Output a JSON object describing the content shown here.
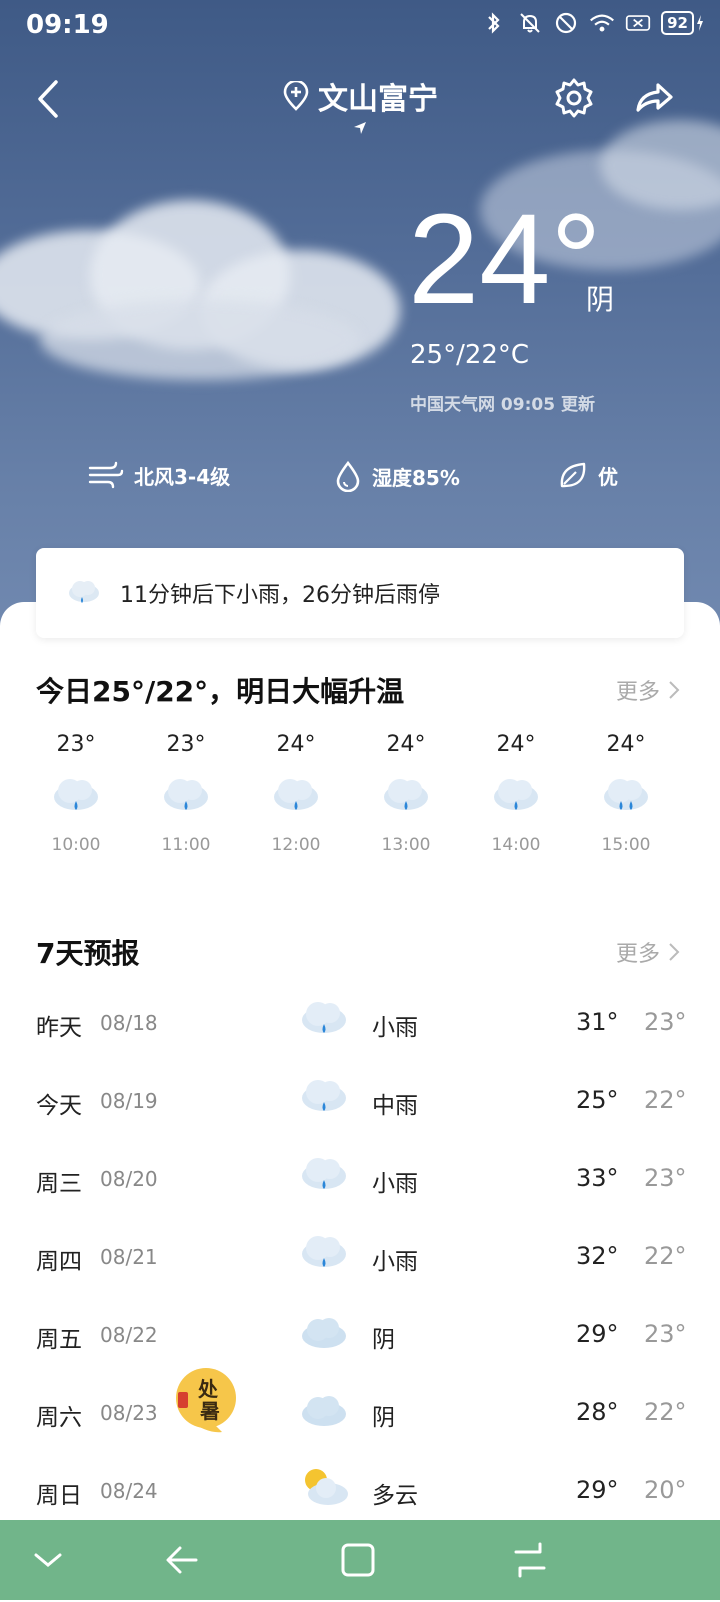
{
  "status": {
    "time": "09:19",
    "battery": "92",
    "icons": [
      "bluetooth-icon",
      "bell-off-icon",
      "do-not-disturb-icon",
      "wifi-icon",
      "no-sim-icon",
      "battery-icon",
      "charging-icon"
    ]
  },
  "header": {
    "location": "文山富宁"
  },
  "current": {
    "temp": "24°",
    "condition": "阴",
    "range": "25°/22°C",
    "updated": "中国天气网 09:05 更新",
    "wind": "北风3-4级",
    "humidity": "湿度85%",
    "air": "优"
  },
  "alert": {
    "text": "11分钟后下小雨，26分钟后雨停"
  },
  "hourly": {
    "title": "今日25°/22°，明日大幅升温",
    "more": "更多",
    "items": [
      {
        "temp": "23°",
        "time": "10:00",
        "icon": "light-rain-icon"
      },
      {
        "temp": "23°",
        "time": "11:00",
        "icon": "light-rain-icon"
      },
      {
        "temp": "24°",
        "time": "12:00",
        "icon": "light-rain-icon"
      },
      {
        "temp": "24°",
        "time": "13:00",
        "icon": "light-rain-icon"
      },
      {
        "temp": "24°",
        "time": "14:00",
        "icon": "light-rain-icon"
      },
      {
        "temp": "24°",
        "time": "15:00",
        "icon": "moderate-rain-icon"
      }
    ]
  },
  "forecast": {
    "title": "7天预报",
    "more": "更多",
    "days": [
      {
        "name": "昨天",
        "date": "08/18",
        "cond": "小雨",
        "hi": "31°",
        "lo": "23°",
        "icon": "light-rain-icon"
      },
      {
        "name": "今天",
        "date": "08/19",
        "cond": "中雨",
        "hi": "25°",
        "lo": "22°",
        "icon": "rain-icon"
      },
      {
        "name": "周三",
        "date": "08/20",
        "cond": "小雨",
        "hi": "33°",
        "lo": "23°",
        "icon": "light-rain-icon"
      },
      {
        "name": "周四",
        "date": "08/21",
        "cond": "小雨",
        "hi": "32°",
        "lo": "22°",
        "icon": "light-rain-icon"
      },
      {
        "name": "周五",
        "date": "08/22",
        "cond": "阴",
        "hi": "29°",
        "lo": "23°",
        "icon": "overcast-icon"
      },
      {
        "name": "周六",
        "date": "08/23",
        "cond": "阴",
        "hi": "28°",
        "lo": "22°",
        "icon": "overcast-icon",
        "badge": "处暑"
      },
      {
        "name": "周日",
        "date": "08/24",
        "cond": "多云",
        "hi": "29°",
        "lo": "20°",
        "icon": "partly-cloudy-icon"
      }
    ]
  },
  "colors": {
    "sky_top": "#3f5a86",
    "navbar": "#71b58a",
    "rain_drop": "#2a86d8"
  }
}
